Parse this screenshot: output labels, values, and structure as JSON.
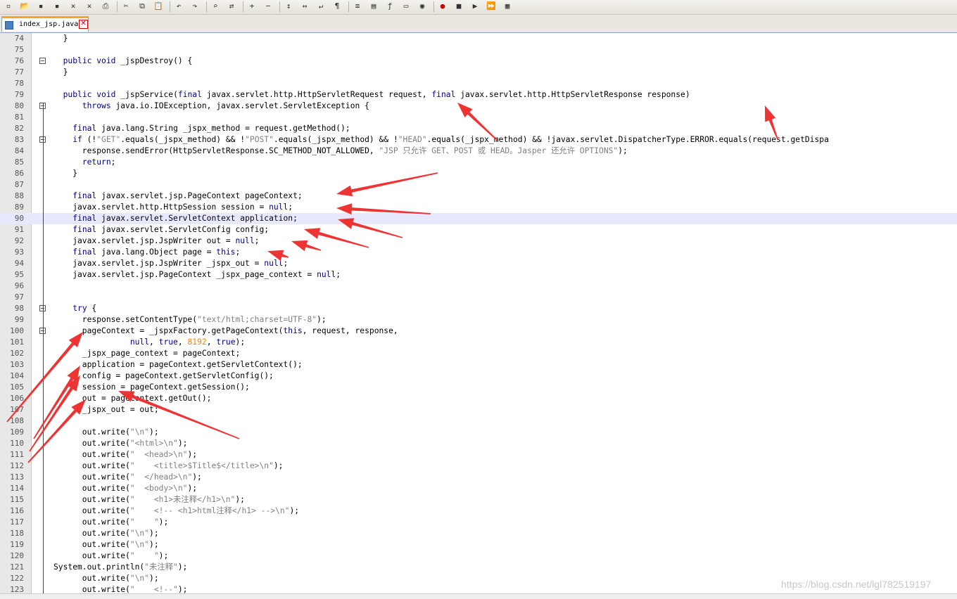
{
  "toolbar": {
    "icons": [
      "new-file-icon",
      "open-file-icon",
      "save-icon",
      "save-all-icon",
      "close-icon",
      "close-all-icon",
      "print-icon",
      "cut-icon",
      "copy-icon",
      "paste-icon",
      "undo-icon",
      "redo-icon",
      "find-icon",
      "replace-icon",
      "zoom-in-icon",
      "zoom-out-icon",
      "sync-vertical-icon",
      "sync-horizontal-icon",
      "word-wrap-icon",
      "show-all-chars-icon",
      "indent-guide-icon",
      "document-map-icon",
      "function-list-icon",
      "folder-icon",
      "monitor-icon",
      "record-macro-icon",
      "stop-record-icon",
      "play-macro-icon",
      "run-macro-icon",
      "save-macro-icon"
    ]
  },
  "tab": {
    "label": "index_jsp.java",
    "close_symbol": "✕"
  },
  "editor": {
    "lines": [
      {
        "n": "74",
        "text": "  }"
      },
      {
        "n": "75",
        "text": ""
      },
      {
        "n": "76",
        "text": "  public void _jspDestroy() {"
      },
      {
        "n": "77",
        "text": "  }"
      },
      {
        "n": "78",
        "text": ""
      },
      {
        "n": "79",
        "text": "  public void _jspService(final javax.servlet.http.HttpServletRequest request, final javax.servlet.http.HttpServletResponse response)"
      },
      {
        "n": "80",
        "text": "      throws java.io.IOException, javax.servlet.ServletException {"
      },
      {
        "n": "81",
        "text": ""
      },
      {
        "n": "82",
        "text": "    final java.lang.String _jspx_method = request.getMethod();"
      },
      {
        "n": "83",
        "text": "    if (!\"GET\".equals(_jspx_method) && !\"POST\".equals(_jspx_method) && !\"HEAD\".equals(_jspx_method) && !javax.servlet.DispatcherType.ERROR.equals(request.getDispa"
      },
      {
        "n": "84",
        "text": "      response.sendError(HttpServletResponse.SC_METHOD_NOT_ALLOWED, \"JSP 只允许 GET、POST 或 HEAD。Jasper 还允许 OPTIONS\");"
      },
      {
        "n": "85",
        "text": "      return;"
      },
      {
        "n": "86",
        "text": "    }"
      },
      {
        "n": "87",
        "text": ""
      },
      {
        "n": "88",
        "text": "    final javax.servlet.jsp.PageContext pageContext;"
      },
      {
        "n": "89",
        "text": "    javax.servlet.http.HttpSession session = null;"
      },
      {
        "n": "90",
        "text": "    final javax.servlet.ServletContext application;"
      },
      {
        "n": "91",
        "text": "    final javax.servlet.ServletConfig config;"
      },
      {
        "n": "92",
        "text": "    javax.servlet.jsp.JspWriter out = null;"
      },
      {
        "n": "93",
        "text": "    final java.lang.Object page = this;"
      },
      {
        "n": "94",
        "text": "    javax.servlet.jsp.JspWriter _jspx_out = null;"
      },
      {
        "n": "95",
        "text": "    javax.servlet.jsp.PageContext _jspx_page_context = null;"
      },
      {
        "n": "96",
        "text": ""
      },
      {
        "n": "97",
        "text": ""
      },
      {
        "n": "98",
        "text": "    try {"
      },
      {
        "n": "99",
        "text": "      response.setContentType(\"text/html;charset=UTF-8\");"
      },
      {
        "n": "100",
        "text": "      pageContext = _jspxFactory.getPageContext(this, request, response,"
      },
      {
        "n": "101",
        "text": "                null, true, 8192, true);"
      },
      {
        "n": "102",
        "text": "      _jspx_page_context = pageContext;"
      },
      {
        "n": "103",
        "text": "      application = pageContext.getServletContext();"
      },
      {
        "n": "104",
        "text": "      config = pageContext.getServletConfig();"
      },
      {
        "n": "105",
        "text": "      session = pageContext.getSession();"
      },
      {
        "n": "106",
        "text": "      out = pageContext.getOut();"
      },
      {
        "n": "107",
        "text": "      _jspx_out = out;"
      },
      {
        "n": "108",
        "text": ""
      },
      {
        "n": "109",
        "text": "      out.write(\"\\n\");"
      },
      {
        "n": "110",
        "text": "      out.write(\"<html>\\n\");"
      },
      {
        "n": "111",
        "text": "      out.write(\"  <head>\\n\");"
      },
      {
        "n": "112",
        "text": "      out.write(\"    <title>$Title$</title>\\n\");"
      },
      {
        "n": "113",
        "text": "      out.write(\"  </head>\\n\");"
      },
      {
        "n": "114",
        "text": "      out.write(\"  <body>\\n\");"
      },
      {
        "n": "115",
        "text": "      out.write(\"    <h1>未注释</h1>\\n\");"
      },
      {
        "n": "116",
        "text": "      out.write(\"    <!-- <h1>html注释</h1> -->\\n\");"
      },
      {
        "n": "117",
        "text": "      out.write(\"    \");"
      },
      {
        "n": "118",
        "text": "      out.write(\"\\n\");"
      },
      {
        "n": "119",
        "text": "      out.write(\"\\n\");"
      },
      {
        "n": "120",
        "text": "      out.write(\"    \");"
      },
      {
        "n": "121",
        "text": "System.out.println(\"未注释\");"
      },
      {
        "n": "122",
        "text": "      out.write(\"\\n\");"
      },
      {
        "n": "123",
        "text": "      out.write(\"    <!--\");"
      }
    ],
    "highlighted_line": "90"
  },
  "watermark": "https://blog.csdn.net/lgl782519197",
  "colors": {
    "annotation_arrow": "#ee3333",
    "keyword": "#00008b",
    "string": "#808080",
    "number": "#ff8000",
    "fold_marker": "#c01010"
  }
}
